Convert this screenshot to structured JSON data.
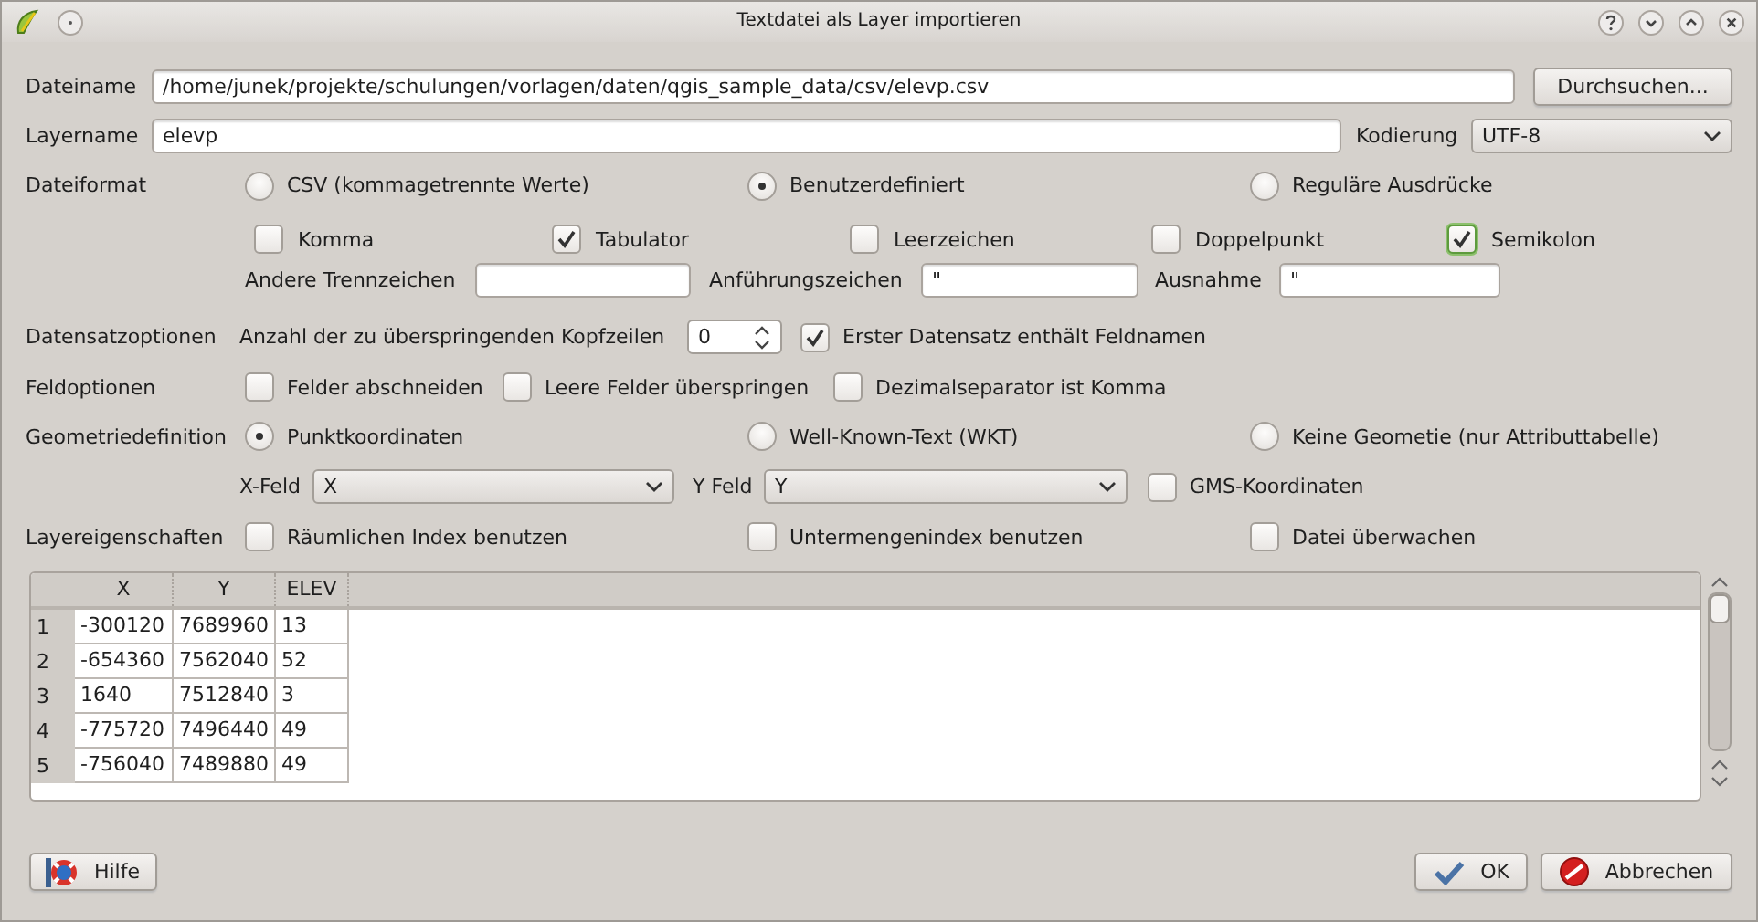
{
  "window": {
    "title": "Textdatei als Layer importieren"
  },
  "file": {
    "label": "Dateiname",
    "value": "/home/junek/projekte/schulungen/vorlagen/daten/qgis_sample_data/csv/elevp.csv",
    "browse_button": "Durchsuchen..."
  },
  "layer": {
    "label": "Layername",
    "value": "elevp",
    "encoding_label": "Kodierung",
    "encoding": "UTF-8"
  },
  "file_format": {
    "label": "Dateiformat",
    "options": [
      {
        "label": "CSV (kommagetrennte Werte)",
        "selected": false
      },
      {
        "label": "Benutzerdefiniert",
        "selected": true
      },
      {
        "label": "Reguläre Ausdrücke",
        "selected": false
      }
    ],
    "delimiters": [
      {
        "label": "Komma",
        "checked": false,
        "focused": false
      },
      {
        "label": "Tabulator",
        "checked": true,
        "focused": false
      },
      {
        "label": "Leerzeichen",
        "checked": false,
        "focused": false
      },
      {
        "label": "Doppelpunkt",
        "checked": false,
        "focused": false
      },
      {
        "label": "Semikolon",
        "checked": true,
        "focused": true
      }
    ],
    "other_delimiters_label": "Andere Trennzeichen",
    "quote": {
      "label": "Anführungszeichen",
      "value": "\""
    },
    "escape": {
      "label": "Ausnahme",
      "value": "\""
    }
  },
  "record_options": {
    "label": "Datensatzoptionen",
    "skip_label": "Anzahl der zu überspringenden Kopfzeilen",
    "skip_value": "0",
    "header": {
      "label": "Erster Datensatz enthält Feldnamen",
      "checked": true
    }
  },
  "field_options": {
    "label": "Feldoptionen",
    "options": [
      {
        "label": "Felder abschneiden",
        "checked": false
      },
      {
        "label": "Leere Felder überspringen",
        "checked": false
      },
      {
        "label": "Dezimalseparator ist Komma",
        "checked": false
      }
    ]
  },
  "geometry": {
    "label": "Geometriedefinition",
    "options": [
      {
        "label": "Punktkoordinaten",
        "selected": true
      },
      {
        "label": "Well-Known-Text (WKT)",
        "selected": false
      },
      {
        "label": "Keine Geometie (nur Attributtabelle)",
        "selected": false
      }
    ],
    "x_label": "X-Feld",
    "x_value": "X",
    "y_label": "Y Feld",
    "y_value": "Y",
    "gms": {
      "label": "GMS-Koordinaten",
      "checked": false
    }
  },
  "layer_properties": {
    "label": "Layereigenschaften",
    "options": [
      {
        "label": "Räumlichen Index benutzen",
        "checked": false
      },
      {
        "label": "Untermengenindex benutzen",
        "checked": false
      },
      {
        "label": "Datei überwachen",
        "checked": false
      }
    ]
  },
  "table": {
    "columns": [
      "X",
      "Y",
      "ELEV"
    ],
    "rows": [
      {
        "number": "1",
        "cells": [
          "-300120",
          "7689960",
          "13"
        ]
      },
      {
        "number": "2",
        "cells": [
          "-654360",
          "7562040",
          "52"
        ]
      },
      {
        "number": "3",
        "cells": [
          "1640",
          "7512840",
          "3"
        ]
      },
      {
        "number": "4",
        "cells": [
          "-775720",
          "7496440",
          "49"
        ]
      },
      {
        "number": "5",
        "cells": [
          "-756040",
          "7489880",
          "49"
        ]
      }
    ]
  },
  "buttons": {
    "help": "Hilfe",
    "ok": "OK",
    "cancel": "Abbrechen"
  }
}
